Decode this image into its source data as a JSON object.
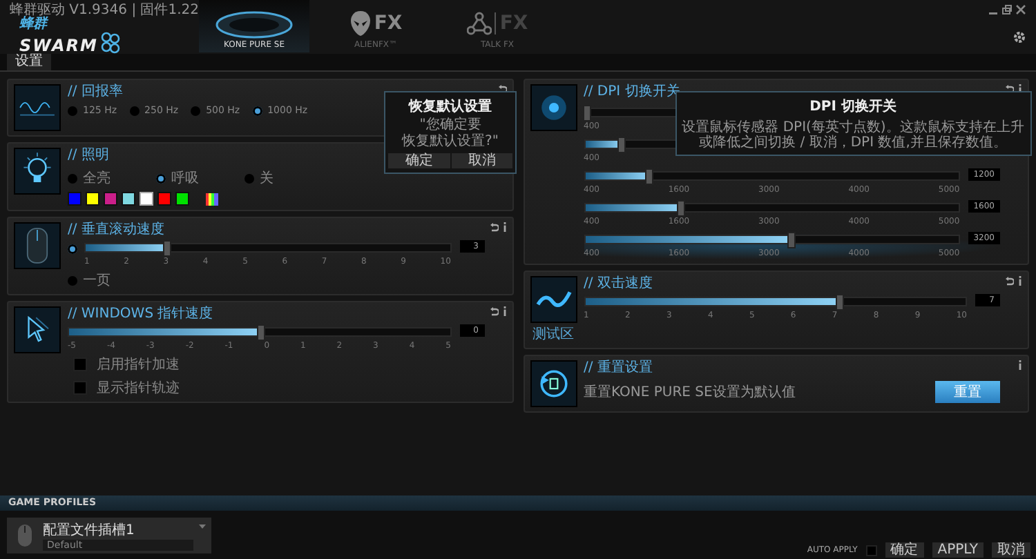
{
  "window": {
    "title": "蜂群驱动 V1.9346 | 固件1.22"
  },
  "logo": {
    "top": "蜂群",
    "bottom": "SWARM"
  },
  "device_tabs": [
    {
      "label": "KONE PURE SE",
      "kind": "mouse",
      "selected": true
    },
    {
      "label": "ALIENFX™",
      "kind": "alien",
      "logo_text": "FX",
      "selected": false
    },
    {
      "label": "TALK FX",
      "kind": "talk",
      "logo_text": "FX",
      "selected": false
    }
  ],
  "tabs": [
    {
      "label": "设置",
      "selected": true
    }
  ],
  "polling_rate": {
    "title": "// 回报率",
    "options": [
      {
        "label": "125 Hz",
        "selected": false
      },
      {
        "label": "250 Hz",
        "selected": false
      },
      {
        "label": "500 Hz",
        "selected": false
      },
      {
        "label": "1000 Hz",
        "selected": true
      }
    ]
  },
  "lighting": {
    "title": "// 照明",
    "options": [
      {
        "label": "全亮",
        "selected": false
      },
      {
        "label": "呼吸",
        "selected": true
      },
      {
        "label": "关",
        "selected": false
      }
    ],
    "swatches": [
      {
        "color": "#0000ff",
        "selected": false
      },
      {
        "color": "#ffff00",
        "selected": false
      },
      {
        "color": "#cc1f8a",
        "selected": false
      },
      {
        "color": "#7fd8e0",
        "selected": false
      },
      {
        "color": "#ffffff",
        "selected": true
      },
      {
        "color": "#ff0000",
        "selected": false
      },
      {
        "color": "#00e000",
        "selected": false
      }
    ]
  },
  "scroll_speed": {
    "title": "// 垂直滚动速度",
    "slider_selected": true,
    "level": 0.222,
    "ticks": [
      "1",
      "2",
      "3",
      "4",
      "5",
      "6",
      "7",
      "8",
      "9",
      "10"
    ],
    "reading": "3",
    "page_option": {
      "label": "一页",
      "selected": false
    }
  },
  "pointer_speed": {
    "title": "// WINDOWS 指针速度",
    "level": 0.5,
    "ticks": [
      "-5",
      "-4",
      "-3",
      "-2",
      "-1",
      "0",
      "1",
      "2",
      "3",
      "4",
      "5"
    ],
    "reading": "0",
    "checkboxes": [
      {
        "label": "启用指针加速",
        "checked": false
      },
      {
        "label": "显示指针轨迹",
        "checked": false
      }
    ]
  },
  "confirm_popup": {
    "title": "恢复默认设置",
    "lines": [
      "\"您确定要",
      "恢复默认设置?\""
    ],
    "buttons": [
      "确定",
      "取消"
    ]
  },
  "dpi": {
    "title": "// DPI 切换开关",
    "rows": [
      {
        "level": 0,
        "ticks": [
          "400"
        ],
        "selected": false
      },
      {
        "level": 0.085,
        "ticks": [
          "400"
        ],
        "selected": false
      },
      {
        "level": 0.17,
        "ticks": [
          "400",
          "1600",
          "3000",
          "4000",
          "5000"
        ],
        "reading": "1200",
        "selected": false
      },
      {
        "level": 0.255,
        "ticks": [
          "400",
          "1600",
          "3000",
          "4000",
          "5000"
        ],
        "reading": "1600",
        "selected": false
      },
      {
        "level": 0.55,
        "ticks": [
          "400",
          "1600",
          "3000",
          "4000",
          "5000"
        ],
        "reading": "3200",
        "selected": true
      }
    ]
  },
  "dpi_tooltip": {
    "title": "DPI 切换开关",
    "text": "设置鼠标传感器 DPI(每英寸点数)。这款鼠标支持在上升或降低之间切换 / 取消，DPI 数值,并且保存数值。"
  },
  "double_click": {
    "title": "// 双击速度",
    "icon_caption": "测试区",
    "level": 0.667,
    "ticks": [
      "1",
      "2",
      "3",
      "4",
      "5",
      "6",
      "7",
      "8",
      "9",
      "10"
    ],
    "reading": "7"
  },
  "reset": {
    "title": "// 重置设置",
    "text": "重置KONE PURE SE设置为默认值",
    "button": "重置"
  },
  "game_profiles": {
    "title": "GAME PROFILES",
    "slot": "配置文件插槽1",
    "value": "Default"
  },
  "footer": {
    "auto_apply": {
      "label": "AUTO APPLY",
      "checked": false
    },
    "buttons": [
      "确定",
      "APPLY",
      "取消"
    ]
  }
}
